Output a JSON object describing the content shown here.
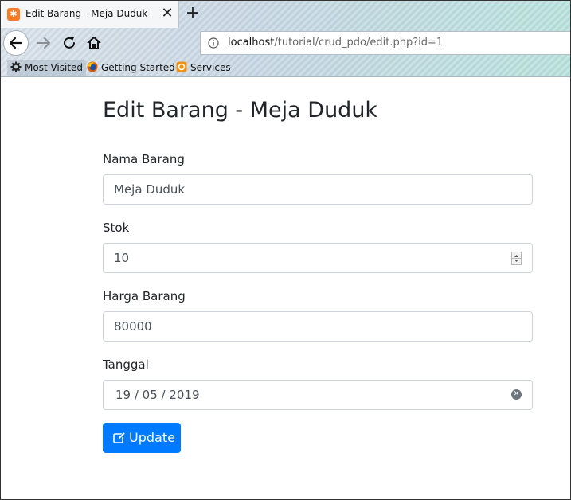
{
  "browser": {
    "tab_title": "Edit Barang - Meja Duduk",
    "new_tab_symbol": "+",
    "close_symbol": "✕",
    "url_host": "localhost",
    "url_path": "/tutorial/crud_pdo/edit.php?id=1",
    "bookmarks": [
      "Most Visited",
      "Getting Started",
      "Services"
    ]
  },
  "page": {
    "title": "Edit Barang - Meja Duduk",
    "fields": [
      {
        "label": "Nama Barang",
        "value": "Meja Duduk"
      },
      {
        "label": "Stok",
        "value": "10"
      },
      {
        "label": "Harga Barang",
        "value": "80000"
      },
      {
        "label": "Tanggal",
        "value": "19 / 05 / 2019"
      }
    ],
    "update_button": "Update"
  },
  "colors": {
    "primary": "#007bff",
    "tab_favicon": "#fb7a24"
  },
  "icons": [
    "xampp-favicon-icon",
    "close-icon",
    "plus-icon",
    "back-icon",
    "forward-icon",
    "reload-icon",
    "home-icon",
    "info-icon",
    "gear-icon",
    "firefox-icon",
    "services-icon",
    "edit-icon",
    "clear-icon",
    "spinner-icon"
  ]
}
